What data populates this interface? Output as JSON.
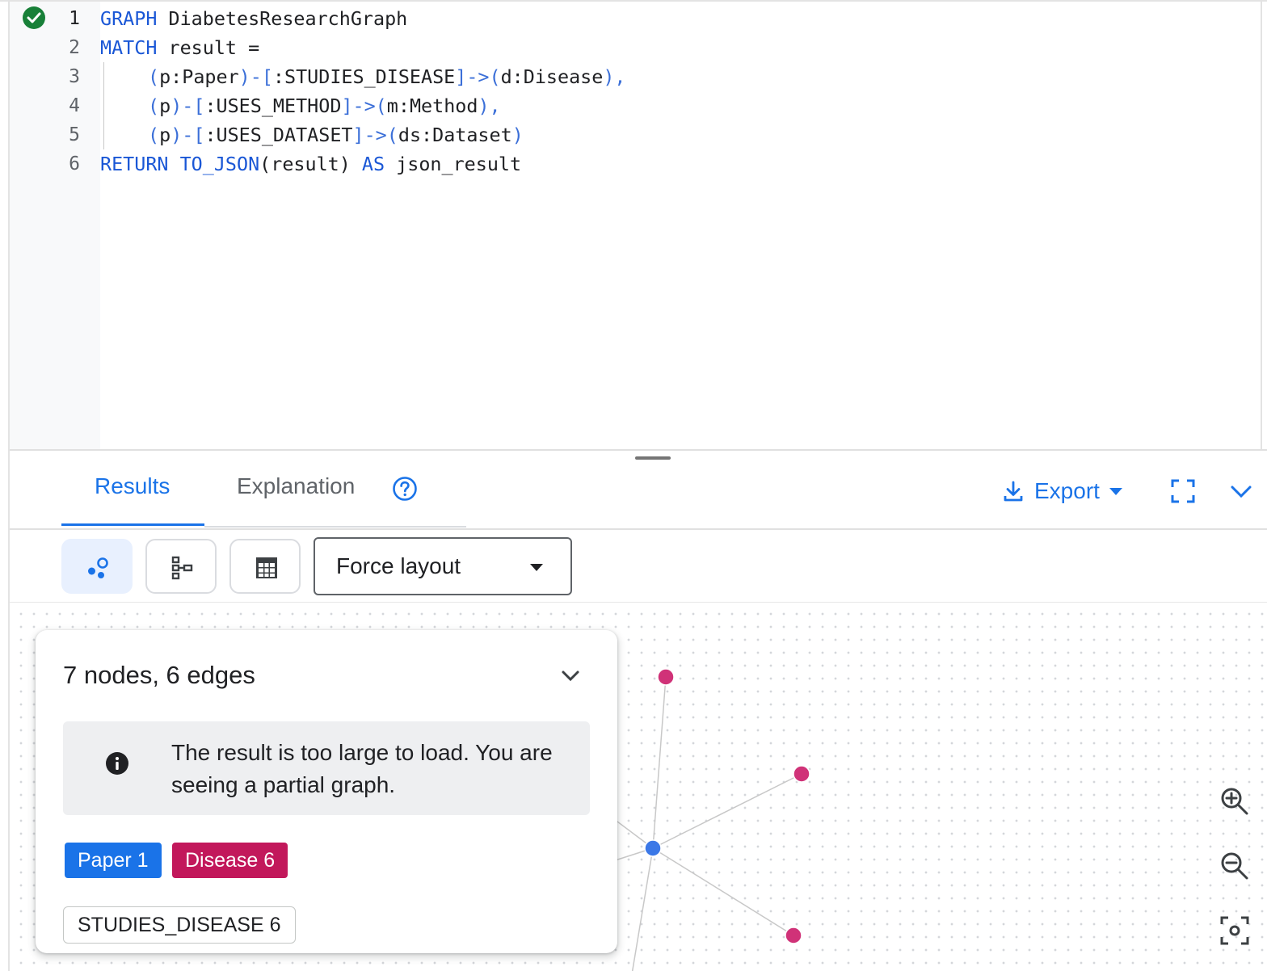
{
  "editor": {
    "status": "query-valid",
    "line_numbers": [
      "1",
      "2",
      "3",
      "4",
      "5",
      "6"
    ],
    "lines": [
      [
        {
          "t": "GRAPH",
          "c": "kw"
        },
        {
          "t": " DiabetesResearchGraph",
          "c": ""
        }
      ],
      [
        {
          "t": "MATCH",
          "c": "kw"
        },
        {
          "t": " result =",
          "c": ""
        }
      ],
      [
        {
          "t": "(",
          "c": "pn"
        },
        {
          "t": "p:Paper",
          "c": ""
        },
        {
          "t": ")-[",
          "c": "pn"
        },
        {
          "t": ":STUDIES_DISEASE",
          "c": ""
        },
        {
          "t": "]->(",
          "c": "pn"
        },
        {
          "t": "d:Disease",
          "c": ""
        },
        {
          "t": "),",
          "c": "pn"
        }
      ],
      [
        {
          "t": "(",
          "c": "pn"
        },
        {
          "t": "p",
          "c": ""
        },
        {
          "t": ")-[",
          "c": "pn"
        },
        {
          "t": ":USES_METHOD",
          "c": ""
        },
        {
          "t": "]->(",
          "c": "pn"
        },
        {
          "t": "m:Method",
          "c": ""
        },
        {
          "t": "),",
          "c": "pn"
        }
      ],
      [
        {
          "t": "(",
          "c": "pn"
        },
        {
          "t": "p",
          "c": ""
        },
        {
          "t": ")-[",
          "c": "pn"
        },
        {
          "t": ":USES_DATASET",
          "c": ""
        },
        {
          "t": "]->(",
          "c": "pn"
        },
        {
          "t": "ds:Dataset",
          "c": ""
        },
        {
          "t": ")",
          "c": "pn"
        }
      ],
      [
        {
          "t": "RETURN",
          "c": "kw"
        },
        {
          "t": " ",
          "c": ""
        },
        {
          "t": "TO_JSON",
          "c": "kw"
        },
        {
          "t": "(result) ",
          "c": ""
        },
        {
          "t": "AS",
          "c": "kw"
        },
        {
          "t": " json_result",
          "c": ""
        }
      ]
    ],
    "indented_lines": [
      3,
      4,
      5
    ]
  },
  "tabs": {
    "results": "Results",
    "explanation": "Explanation"
  },
  "actions": {
    "export": "Export"
  },
  "toolbar": {
    "views": [
      "graph-view",
      "schema-view",
      "table-view"
    ],
    "layout": "Force layout"
  },
  "summary": {
    "title": "7 nodes, 6 edges",
    "notice": "The result is too large to load. You are seeing a partial graph.",
    "node_labels": [
      {
        "label": "Paper",
        "count": "1"
      },
      {
        "label": "Disease",
        "count": "6"
      }
    ],
    "edge_labels": [
      {
        "label": "STUDIES_DISEASE",
        "count": "6"
      }
    ]
  },
  "colors": {
    "accent": "#1a73e8",
    "paper_node": "#3b78e7",
    "disease_node": "#d03278",
    "status_ok": "#188038"
  }
}
